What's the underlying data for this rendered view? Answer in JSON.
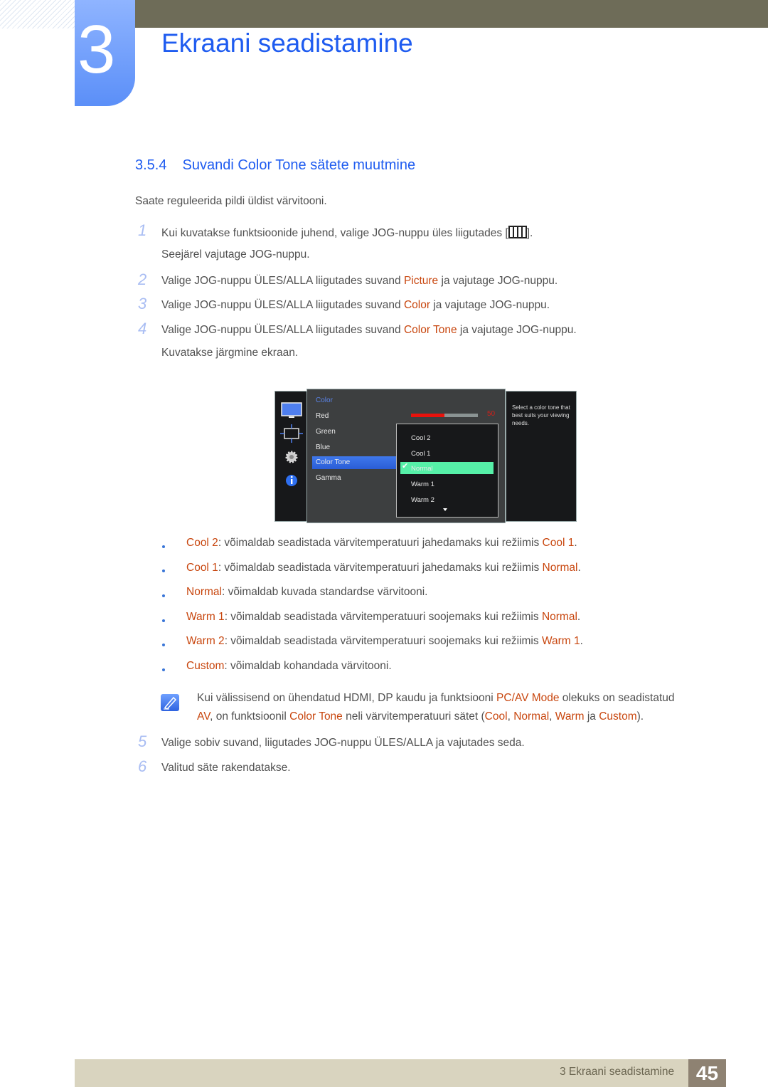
{
  "chapter": {
    "number": "3",
    "title": "Ekraani seadistamine"
  },
  "section": {
    "number": "3.5.4",
    "title": "Suvandi Color Tone sätete muutmine"
  },
  "intro": "Saate reguleerida pildi üldist värvitooni.",
  "steps": [
    {
      "n": "1",
      "parts": [
        "Kui kuvatakse funktsioonide juhend, valige JOG-nuppu üles liigutades [",
        "]."
      ],
      "cont": "Seejärel vajutage JOG-nuppu."
    },
    {
      "n": "2",
      "pre": "Valige JOG-nuppu ÜLES/ALLA liigutades suvand ",
      "hl": "Picture",
      "post": " ja vajutage JOG-nuppu."
    },
    {
      "n": "3",
      "pre": "Valige JOG-nuppu ÜLES/ALLA liigutades suvand ",
      "hl": "Color",
      "post": " ja vajutage JOG-nuppu."
    },
    {
      "n": "4",
      "pre": "Valige JOG-nuppu ÜLES/ALLA liigutades suvand ",
      "hl": "Color Tone",
      "post": " ja vajutage JOG-nuppu.",
      "cont": "Kuvatakse järgmine ekraan."
    },
    {
      "n": "5",
      "text": "Valige sobiv suvand, liigutades JOG-nuppu ÜLES/ALLA ja vajutades seda."
    },
    {
      "n": "6",
      "text": "Valitud säte rakendatakse."
    }
  ],
  "osd": {
    "menu_title": "Color",
    "items": [
      "Red",
      "Green",
      "Blue",
      "Color Tone",
      "Gamma"
    ],
    "selected_item": "Color Tone",
    "red_value": "50",
    "red_fraction": 0.5,
    "dropdown": [
      "Cool 2",
      "Cool 1",
      "Normal",
      "Warm 1",
      "Warm 2"
    ],
    "dropdown_selected": "Normal",
    "help": "Select a color tone that best suits your viewing needs."
  },
  "bullets": [
    {
      "hl": "Cool 2",
      "text": ": võimaldab seadistada värvitemperatuuri jahedamaks kui režiimis ",
      "hl2": "Cool 1",
      "end": "."
    },
    {
      "hl": "Cool 1",
      "text": ": võimaldab seadistada värvitemperatuuri jahedamaks kui režiimis ",
      "hl2": "Normal",
      "end": "."
    },
    {
      "hl": "Normal",
      "text": ": võimaldab kuvada standardse värvitooni.",
      "hl2": "",
      "end": ""
    },
    {
      "hl": "Warm 1",
      "text": ": võimaldab seadistada värvitemperatuuri soojemaks kui režiimis ",
      "hl2": "Normal",
      "end": "."
    },
    {
      "hl": "Warm 2",
      "text": ": võimaldab seadistada värvitemperatuuri soojemaks kui režiimis ",
      "hl2": "Warm 1",
      "end": "."
    },
    {
      "hl": "Custom",
      "text": ": võimaldab kohandada värvitooni.",
      "hl2": "",
      "end": ""
    }
  ],
  "note": {
    "l1_pre": "Kui välissisend on ühendatud HDMI, DP kaudu ja funktsiooni ",
    "l1_hl": "PC/AV Mode",
    "l1_post": " olekuks on seadistatud",
    "l2_hl1": "AV",
    "l2_a": ", on funktsioonil ",
    "l2_hl2": "Color Tone",
    "l2_b": " neli värvitemperatuuri sätet (",
    "l2_hl3": "Cool",
    "l2_c": ", ",
    "l2_hl4": "Normal",
    "l2_d": ", ",
    "l2_hl5": "Warm",
    "l2_e": " ja ",
    "l2_hl6": "Custom",
    "l2_f": ")."
  },
  "footer": {
    "text": "3 Ekraani seadistamine",
    "page": "45"
  },
  "colors": {
    "accent_blue": "#1f5cf0",
    "highlight": "#c8460e",
    "selected_green": "#56f0a8"
  }
}
